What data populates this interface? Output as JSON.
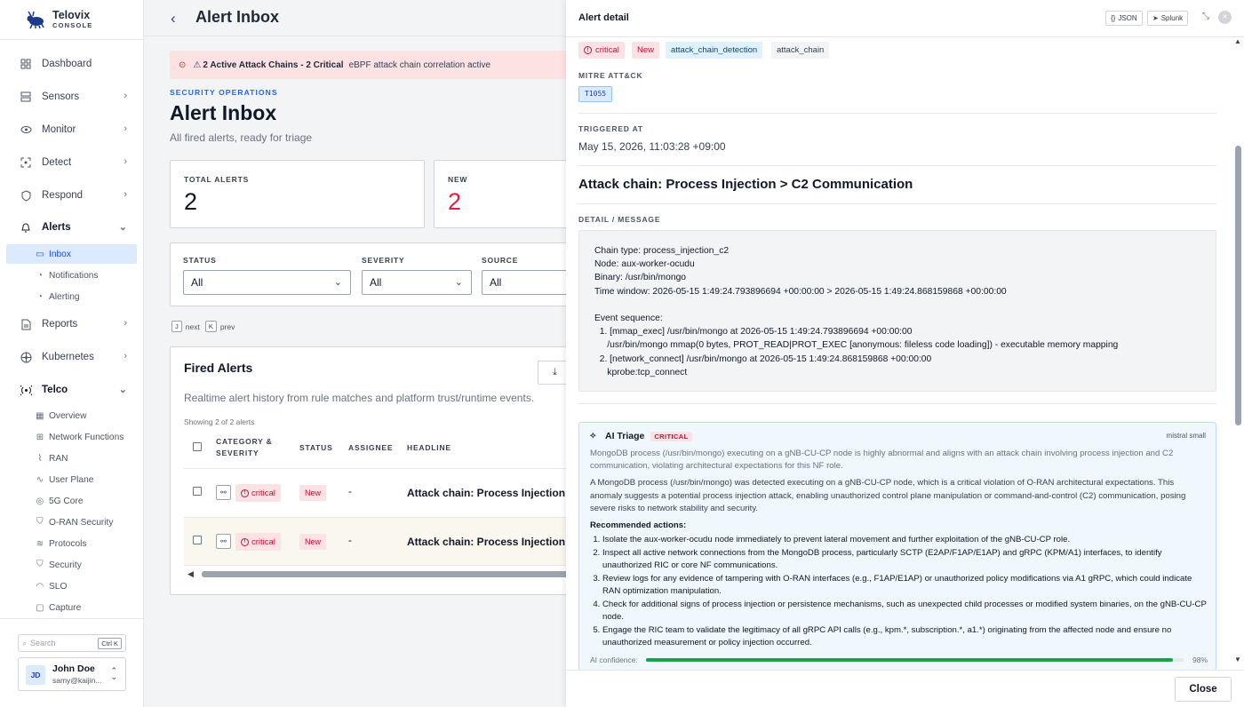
{
  "brand": {
    "name": "Telovix",
    "sub": "CONSOLE"
  },
  "nav": {
    "dashboard": "Dashboard",
    "sensors": "Sensors",
    "monitor": "Monitor",
    "detect": "Detect",
    "respond": "Respond",
    "alerts": "Alerts",
    "inbox": "Inbox",
    "notifications": "Notifications",
    "alerting": "Alerting",
    "reports": "Reports",
    "kubernetes": "Kubernetes",
    "telco": "Telco",
    "telco_items": [
      "Overview",
      "Network Functions",
      "RAN",
      "User Plane",
      "5G Core",
      "O-RAN Security",
      "Protocols",
      "Security",
      "SLO",
      "Capture"
    ]
  },
  "search": {
    "placeholder": "Search",
    "shortcut": "Ctrl K"
  },
  "user": {
    "initials": "JD",
    "name": "John Doe",
    "email": "samy@kaijin..."
  },
  "topbar": {
    "title": "Alert Inbox"
  },
  "banner": {
    "bold": "2 Active Attack Chains - 2 Critical",
    "text": "eBPF attack chain correlation active"
  },
  "page": {
    "eyebrow": "SECURITY OPERATIONS",
    "title": "Alert Inbox",
    "subtitle": "All fired alerts, ready for triage"
  },
  "stats": [
    {
      "label": "TOTAL ALERTS",
      "value": "2"
    },
    {
      "label": "NEW",
      "value": "2"
    }
  ],
  "filters": [
    {
      "label": "STATUS",
      "value": "All"
    },
    {
      "label": "SEVERITY",
      "value": "All"
    },
    {
      "label": "SOURCE",
      "value": "All"
    }
  ],
  "hints": {
    "next_key": "J",
    "next": "next",
    "prev_key": "K",
    "prev": "prev"
  },
  "fired": {
    "title": "Fired Alerts",
    "description": "Realtime alert history from rule matches and platform trust/runtime events.",
    "showing": "Showing 2 of 2 alerts",
    "columns": [
      "CATEGORY &",
      "SEVERITY",
      "STATUS",
      "ASSIGNEE",
      "HEADLINE"
    ],
    "rows": [
      {
        "severity": "critical",
        "status": "New",
        "assignee": "-",
        "headline": "Attack chain: Process Injection >"
      },
      {
        "severity": "critical",
        "status": "New",
        "assignee": "-",
        "headline": "Attack chain: Process Injection >"
      }
    ]
  },
  "detail": {
    "header": "Alert detail",
    "json_btn": "JSON",
    "splunk_btn": "Splunk",
    "tags": [
      "critical",
      "New",
      "attack_chain_detection",
      "attack_chain"
    ],
    "mitre_label": "MITRE ATT&CK",
    "mitre_tag": "T1055",
    "triggered_label": "TRIGGERED AT",
    "triggered_at": "May 15, 2026, 11:03:28 +09:00",
    "title": "Attack chain: Process Injection > C2 Communication",
    "message_label": "DETAIL / MESSAGE",
    "message": "Chain type: process_injection_c2\nNode: aux-worker-ocudu\nBinary: /usr/bin/mongo\nTime window: 2026-05-15 1:49:24.793896694 +00:00:00 > 2026-05-15 1:49:24.868159868 +00:00:00\n\nEvent sequence:\n  1. [mmap_exec] /usr/bin/mongo at 2026-05-15 1:49:24.793896694 +00:00:00\n     /usr/bin/mongo mmap(0 bytes, PROT_READ|PROT_EXEC [anonymous: fileless code loading]) - executable memory mapping\n  2. [network_connect] /usr/bin/mongo at 2026-05-15 1:49:24.868159868 +00:00:00\n     kprobe:tcp_connect",
    "close": "Close"
  },
  "triage": {
    "title": "AI Triage",
    "badge": "CRITICAL",
    "model": "mistral small",
    "summary": "MongoDB process (/usr/bin/mongo) executing on a gNB-CU-CP node is highly abnormal and aligns with an attack chain involving process injection and C2 communication, violating architectural expectations for this NF role.",
    "body": "A MongoDB process (/usr/bin/mongo) was detected executing on a gNB-CU-CP node, which is a critical violation of O-RAN architectural expectations. This anomaly suggests a potential process injection attack, enabling unauthorized control plane manipulation or command-and-control (C2) communication, posing severe risks to network stability and security.",
    "rec_label": "Recommended actions:",
    "actions": [
      "Isolate the aux-worker-ocudu node immediately to prevent lateral movement and further exploitation of the gNB-CU-CP role.",
      "Inspect all active network connections from the MongoDB process, particularly SCTP (E2AP/F1AP/E1AP) and gRPC (KPM/A1) interfaces, to identify unauthorized RIC or core NF communications.",
      "Review logs for any evidence of tampering with O-RAN interfaces (e.g., F1AP/E1AP) or unauthorized policy modifications via A1 gRPC, which could indicate RAN optimization manipulation.",
      "Check for additional signs of process injection or persistence mechanisms, such as unexpected child processes or modified system binaries, on the gNB-CU-CP node.",
      "Engage the RIC team to validate the legitimacy of all gRPC API calls (e.g., kpm.*, subscription.*, a1.*) originating from the affected node and ensure no unauthorized measurement or policy injection occurred."
    ],
    "confidence_label": "AI confidence:",
    "confidence": 0.98,
    "confidence_text": "98%"
  }
}
